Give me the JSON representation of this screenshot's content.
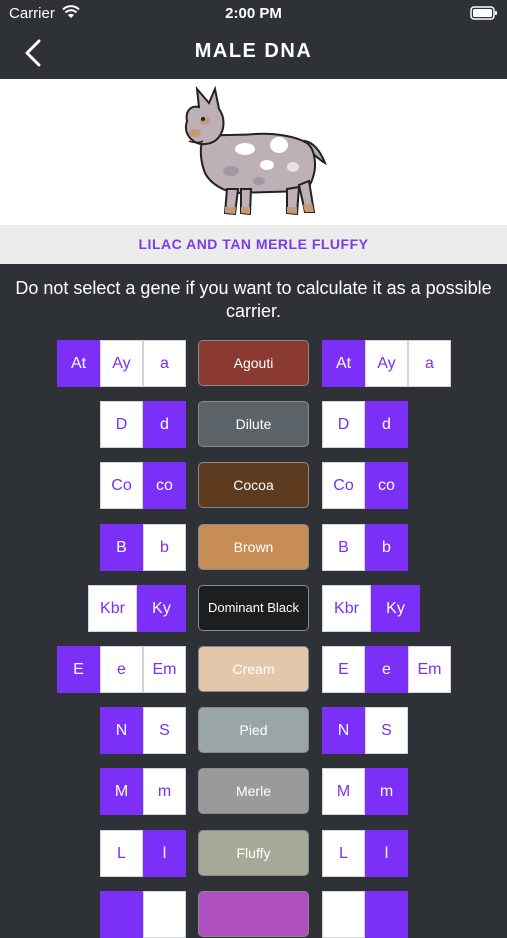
{
  "status_bar": {
    "carrier": "Carrier",
    "time": "2:00 PM"
  },
  "nav": {
    "title": "MALE DNA"
  },
  "dog_name": "LILAC AND TAN MERLE FLUFFY",
  "instruction": "Do not select a gene if you want to calculate it as a possible carrier.",
  "rows": [
    {
      "gene": "Agouti",
      "color": "#8b3a32",
      "left": [
        {
          "label": "At",
          "selected": true
        },
        {
          "label": "Ay",
          "selected": false
        },
        {
          "label": "a",
          "selected": false
        }
      ],
      "right": [
        {
          "label": "At",
          "selected": true
        },
        {
          "label": "Ay",
          "selected": false
        },
        {
          "label": "a",
          "selected": false
        }
      ]
    },
    {
      "gene": "Dilute",
      "color": "#5c6368",
      "left": [
        {
          "label": "D",
          "selected": false
        },
        {
          "label": "d",
          "selected": true
        }
      ],
      "right": [
        {
          "label": "D",
          "selected": false
        },
        {
          "label": "d",
          "selected": true
        }
      ]
    },
    {
      "gene": "Cocoa",
      "color": "#5e3a1f",
      "left": [
        {
          "label": "Co",
          "selected": false
        },
        {
          "label": "co",
          "selected": true
        }
      ],
      "right": [
        {
          "label": "Co",
          "selected": false
        },
        {
          "label": "co",
          "selected": true
        }
      ]
    },
    {
      "gene": "Brown",
      "color": "#c68d56",
      "left": [
        {
          "label": "B",
          "selected": true
        },
        {
          "label": "b",
          "selected": false
        }
      ],
      "right": [
        {
          "label": "B",
          "selected": false
        },
        {
          "label": "b",
          "selected": true
        }
      ]
    },
    {
      "gene": "Dominant Black",
      "color": "#1d1e20",
      "left": [
        {
          "label": "Kbr",
          "selected": false
        },
        {
          "label": "Ky",
          "selected": true
        }
      ],
      "right": [
        {
          "label": "Kbr",
          "selected": false
        },
        {
          "label": "Ky",
          "selected": true
        }
      ]
    },
    {
      "gene": "Cream",
      "color": "#e3c7aa",
      "left": [
        {
          "label": "E",
          "selected": true
        },
        {
          "label": "e",
          "selected": false
        },
        {
          "label": "Em",
          "selected": false
        }
      ],
      "right": [
        {
          "label": "E",
          "selected": false
        },
        {
          "label": "e",
          "selected": true
        },
        {
          "label": "Em",
          "selected": false
        }
      ]
    },
    {
      "gene": "Pied",
      "color": "#9aa6a6",
      "left": [
        {
          "label": "N",
          "selected": true
        },
        {
          "label": "S",
          "selected": false
        }
      ],
      "right": [
        {
          "label": "N",
          "selected": true
        },
        {
          "label": "S",
          "selected": false
        }
      ]
    },
    {
      "gene": "Merle",
      "color": "#9a9a9a",
      "left": [
        {
          "label": "M",
          "selected": true
        },
        {
          "label": "m",
          "selected": false
        }
      ],
      "right": [
        {
          "label": "M",
          "selected": false
        },
        {
          "label": "m",
          "selected": true
        }
      ]
    },
    {
      "gene": "Fluffy",
      "color": "#a8a898",
      "left": [
        {
          "label": "L",
          "selected": false
        },
        {
          "label": "l",
          "selected": true
        }
      ],
      "right": [
        {
          "label": "L",
          "selected": false
        },
        {
          "label": "l",
          "selected": true
        }
      ]
    },
    {
      "gene": "",
      "color": "#b050c0",
      "left": [
        {
          "label": "",
          "selected": true
        },
        {
          "label": "",
          "selected": false
        }
      ],
      "right": [
        {
          "label": "",
          "selected": false
        },
        {
          "label": "",
          "selected": true
        }
      ]
    }
  ]
}
